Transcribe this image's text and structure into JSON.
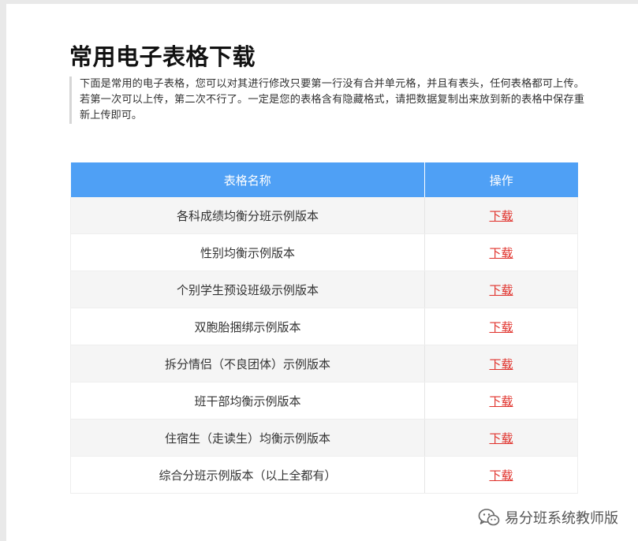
{
  "page": {
    "title": "常用电子表格下载",
    "description": "下面是常用的电子表格，您可以对其进行修改只要第一行没有合并单元格，并且有表头，任何表格都可上传。若第一次可以上传，第二次不行了。一定是您的表格含有隐藏格式，请把数据复制出来放到新的表格中保存重新上传即可。"
  },
  "table": {
    "headers": {
      "name": "表格名称",
      "action": "操作"
    },
    "rows": [
      {
        "name": "各科成绩均衡分班示例版本",
        "action": "下载"
      },
      {
        "name": "性别均衡示例版本",
        "action": "下载"
      },
      {
        "name": "个别学生预设班级示例版本",
        "action": "下载"
      },
      {
        "name": "双胞胎捆绑示例版本",
        "action": "下载"
      },
      {
        "name": "拆分情侣（不良团体）示例版本",
        "action": "下载"
      },
      {
        "name": "班干部均衡示例版本",
        "action": "下载"
      },
      {
        "name": "住宿生（走读生）均衡示例版本",
        "action": "下载"
      },
      {
        "name": "综合分班示例版本（以上全都有）",
        "action": "下载"
      }
    ]
  },
  "watermark": {
    "icon": "wechat-icon",
    "text": "易分班系统教师版"
  },
  "colors": {
    "header_bg": "#4fa0f5",
    "link": "#e0302a",
    "stripe": "#f5f5f5"
  }
}
